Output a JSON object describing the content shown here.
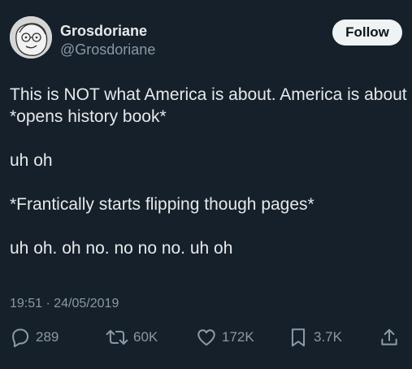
{
  "user": {
    "display_name": "Grosdoriane",
    "handle": "@Grosdoriane"
  },
  "follow_label": "Follow",
  "tweet": {
    "lines": [
      "This is NOT what America is about. America is about",
      "*opens history book*",
      "",
      "uh oh",
      "",
      "*Frantically starts flipping though pages*",
      "",
      "uh oh. oh no. no no no. uh oh"
    ],
    "timestamp": "19:51 · 24/05/2019"
  },
  "stats": {
    "replies": "289",
    "retweets": "60K",
    "likes": "172K",
    "bookmarks": "3.7K"
  },
  "colors": {
    "background": "#15202b",
    "text": "#e7e9ea",
    "muted": "#8b98a5",
    "follow_button": "#eff3f4"
  },
  "icons": [
    "reply-icon",
    "retweet-icon",
    "like-icon",
    "bookmark-icon",
    "share-icon"
  ]
}
